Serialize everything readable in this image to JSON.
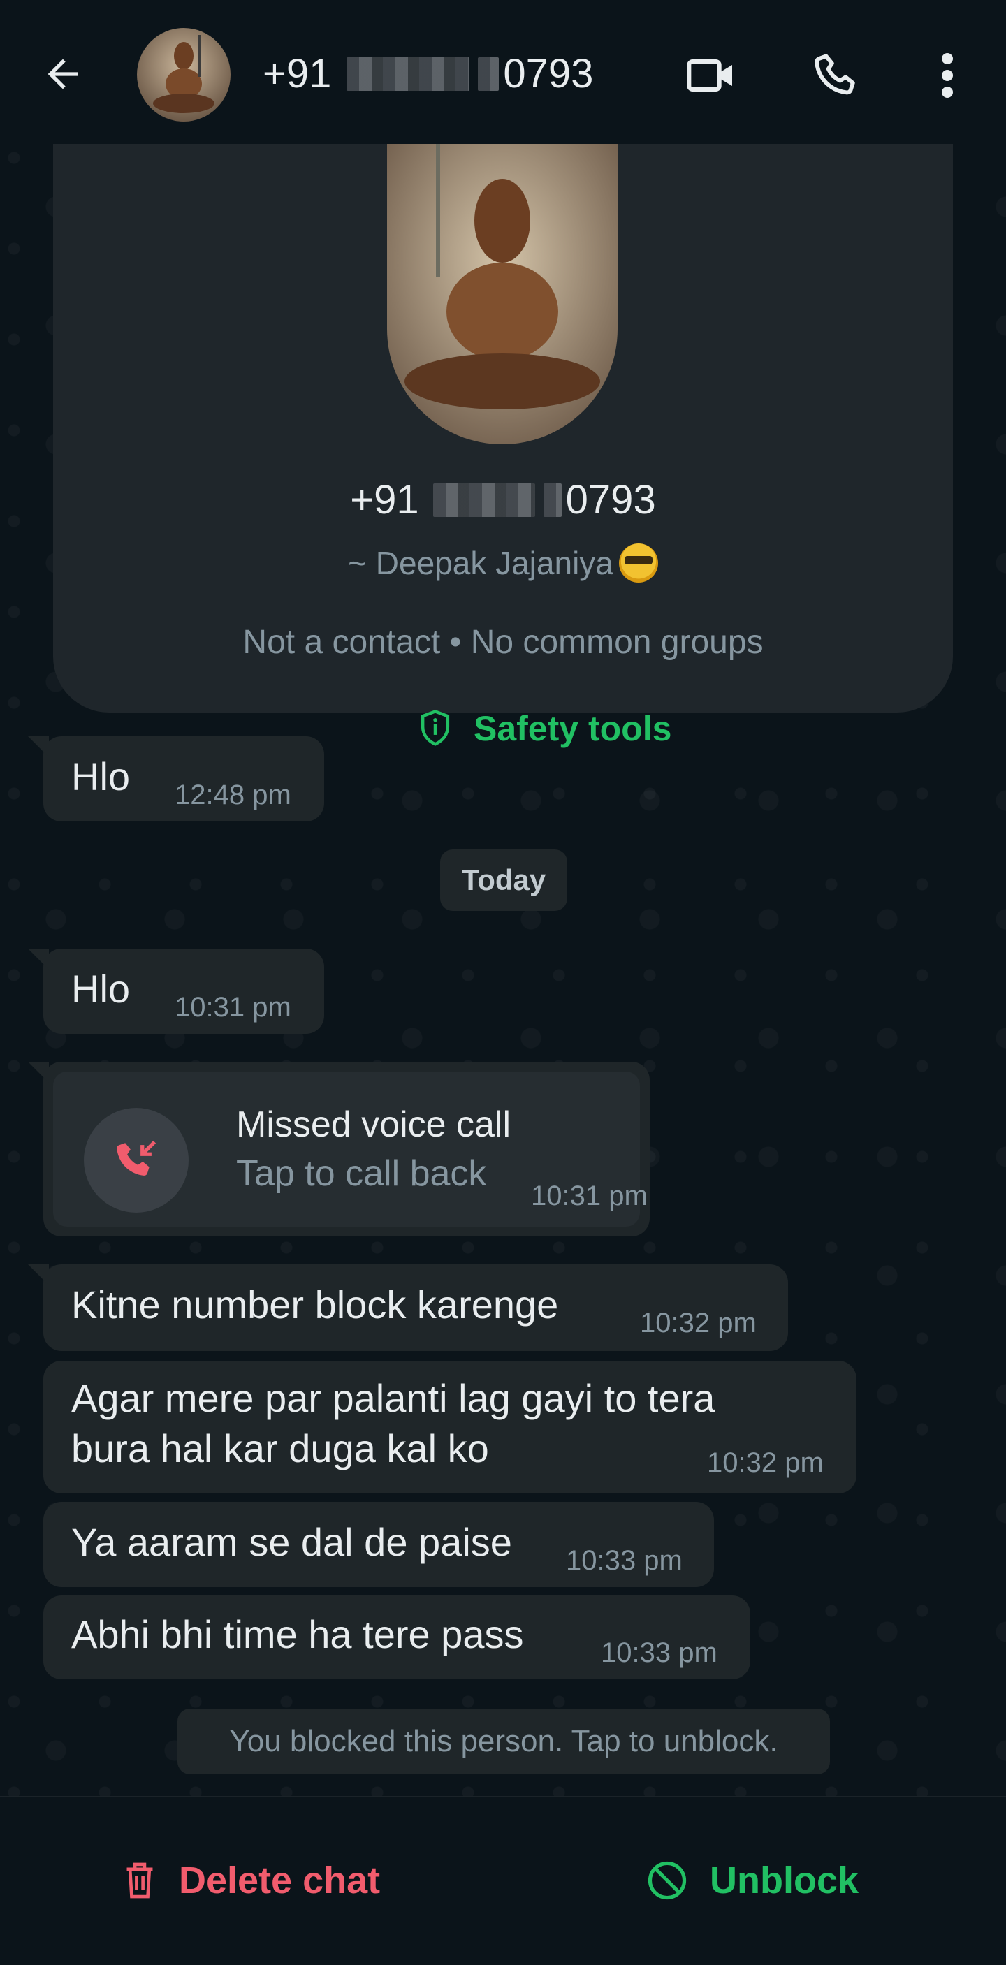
{
  "header": {
    "phone_prefix": "+91",
    "phone_suffix": "0793",
    "back_icon": "back-arrow-icon",
    "video_icon": "video-call-icon",
    "call_icon": "voice-call-icon",
    "menu_icon": "more-vert-icon"
  },
  "profile": {
    "phone_prefix": "+91",
    "phone_suffix": "0793",
    "alias": "~ Deepak Jajaniya",
    "info": "Not a contact • No common groups",
    "safety_label": "Safety tools"
  },
  "messages": [
    {
      "text": "Hlo",
      "time": "12:48 pm"
    },
    {
      "text": "Hlo",
      "time": "10:31 pm"
    },
    {
      "text": "Kitne number block karenge",
      "time": "10:32 pm"
    },
    {
      "line1": "Agar mere par palanti lag gayi to tera",
      "line2": "bura hal kar duga kal ko",
      "time": "10:32 pm"
    },
    {
      "text": "Ya aaram se dal de paise",
      "time": "10:33 pm"
    },
    {
      "text": "Abhi bhi time ha tere pass",
      "time": "10:33 pm"
    }
  ],
  "date_chip": "Today",
  "missed_call": {
    "title": "Missed voice call",
    "subtitle": "Tap to call back",
    "time": "10:31 pm"
  },
  "blocked_notice": "You blocked this person. Tap to unblock.",
  "bottom": {
    "delete_label": "Delete chat",
    "unblock_label": "Unblock"
  },
  "colors": {
    "background": "#0b141a",
    "bubble": "#1f2629",
    "accent_green": "#21c063",
    "danger_red": "#f15c6d",
    "muted_text": "#8696a0"
  }
}
